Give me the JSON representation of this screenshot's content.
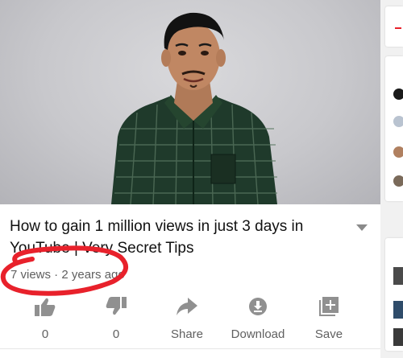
{
  "video": {
    "title": "How to gain 1 million views in just 3 days in YouTube | Very Secret Tips",
    "meta": "7 views · 2 years ago"
  },
  "actions": [
    {
      "icon": "thumbs-up-icon",
      "label": "0"
    },
    {
      "icon": "thumbs-down-icon",
      "label": "0"
    },
    {
      "icon": "share-icon",
      "label": "Share"
    },
    {
      "icon": "download-icon",
      "label": "Download"
    },
    {
      "icon": "save-to-playlist-icon",
      "label": "Save"
    }
  ],
  "colors": {
    "annotation": "#e8212b",
    "text": "#111111",
    "secondary": "#606060"
  }
}
